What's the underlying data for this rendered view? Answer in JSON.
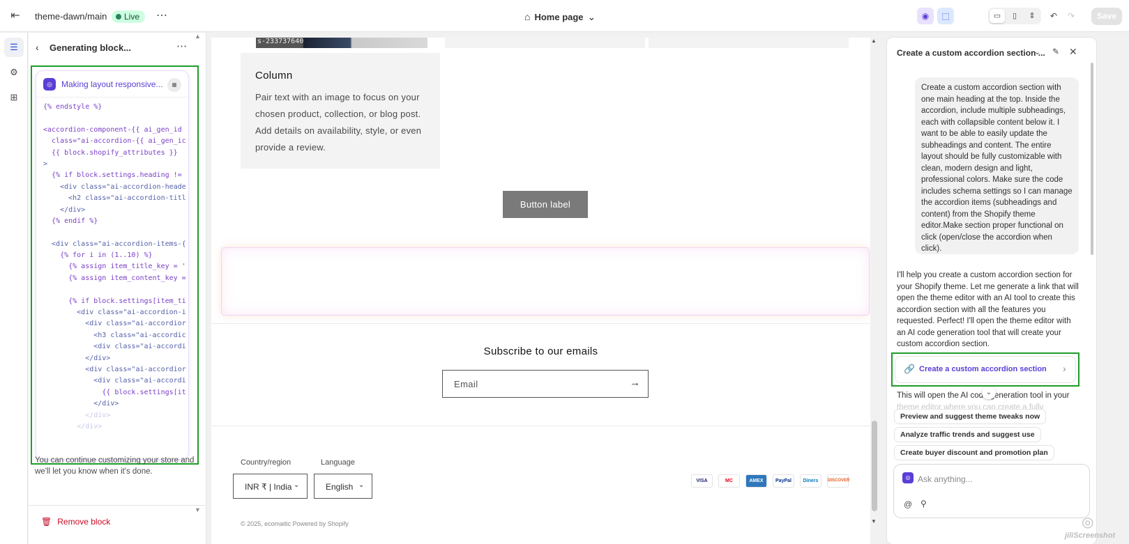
{
  "topbar": {
    "theme_name": "theme-dawn/main",
    "live_badge": "Live",
    "more": "⋯",
    "page_selector": "Home page",
    "save_label": "Save",
    "icons": [
      "exit-icon",
      "home-icon",
      "chevron-down-icon",
      "ai-sidekick-icon",
      "inspector-icon",
      "desktop-icon",
      "mobile-icon",
      "fullscreen-icon",
      "undo-icon",
      "redo-icon"
    ],
    "colors": {
      "live_bg": "#cdfee1",
      "live_text": "#0c5132"
    }
  },
  "rail": {
    "items": [
      "sections-icon",
      "settings-icon",
      "apps-icon"
    ]
  },
  "sidebar": {
    "title": "Generating block...",
    "status": "Making layout responsive...",
    "code_lines": [
      "{% endstyle %}",
      "",
      "<accordion-component-{{ ai_gen_id",
      "  class=\"ai-accordion-{{ ai_gen_ic",
      "  {{ block.shopify_attributes }}",
      ">",
      "  {% if block.settings.heading !=",
      "    <div class=\"ai-accordion-heade",
      "      <h2 class=\"ai-accordion-titl",
      "    </div>",
      "  {% endif %}",
      "",
      "  <div class=\"ai-accordion-items-{",
      "    {% for i in (1..10) %}",
      "      {% assign item_title_key = '",
      "      {% assign item_content_key =",
      "",
      "      {% if block.settings[item_ti",
      "        <div class=\"ai-accordion-i",
      "          <div class=\"ai-accordior",
      "            <h3 class=\"ai-accordic",
      "            <div class=\"ai-accordi",
      "          </div>",
      "          <div class=\"ai-accordior",
      "            <div class=\"ai-accordi",
      "              {{ block.settings[it",
      "            </div>",
      "          </div>",
      "        </div>"
    ],
    "note": "You can continue customizing your store and we'll let you know when it's done.",
    "remove_label": "Remove block",
    "colors": {
      "highlight": "#1f9d2a",
      "remove": "#c70a24"
    }
  },
  "canvas": {
    "image_caption": "s-233737640",
    "column_title": "Column",
    "column_text": "Pair text with an image to focus on your chosen product, collection, or blog post. Add details on availability, style, or even provide a review.",
    "button_label": "Button label",
    "subscribe_title": "Subscribe to our emails",
    "email_placeholder": "Email",
    "country_label": "Country/region",
    "country_value": "INR ₹ | India",
    "language_label": "Language",
    "language_value": "English",
    "payments": [
      "VISA",
      "MC",
      "AMEX",
      "PayPal",
      "Diners",
      "DISCOVER"
    ],
    "copyright": "© 2025, ecomaitic Powered by Shopify"
  },
  "chat": {
    "title": "Create a custom accordion section ...",
    "user_message": "Create a custom accordion section with one main heading at the top. Inside the accordion, include multiple subheadings, each with collapsible content below it. I want to be able to easily update the subheadings and content. The entire layout should be fully customizable with clean, modern design and light, professional colors. Make sure the code includes schema settings so I can manage the accordion items (subheadings and content) from the Shopify theme editor.Make section proper functional on click (open/close the accordion when click).",
    "assistant_reply": "I'll help you create a custom accordion section for your Shopify theme. Let me generate a link that will open the theme editor with an AI tool to create this accordion section with all the features you requested. Perfect! I'll open the theme editor with an AI code generation tool that will create your custom accordion section.",
    "link_label": "Create a custom accordion section",
    "continuation": "This will open the AI code generation tool in your",
    "continuation_faded": "theme editor where you can create a fully",
    "suggestions": [
      "Preview and suggest theme tweaks now",
      "Analyze traffic trends and suggest use",
      "Create buyer discount and promotion plan"
    ],
    "input_placeholder": "Ask anything...",
    "colors": {
      "accent": "#5b3ed6",
      "highlight": "#1f9d2a"
    }
  },
  "watermark": {
    "text": "jiliScreenshot"
  }
}
